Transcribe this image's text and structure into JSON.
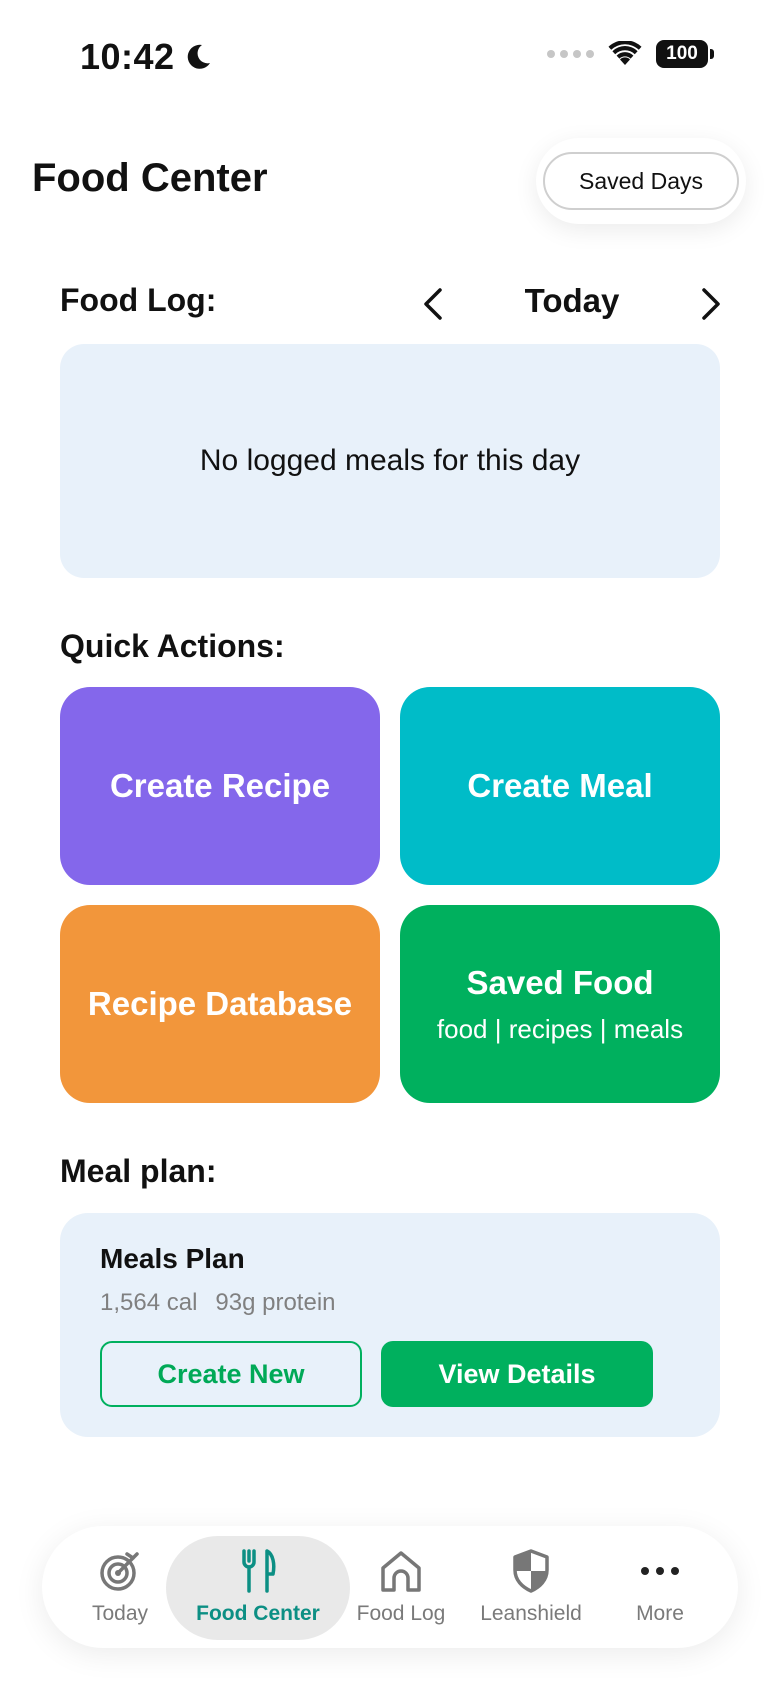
{
  "status_bar": {
    "time": "10:42",
    "battery": "100"
  },
  "header": {
    "title": "Food Center",
    "saved_days_label": "Saved Days"
  },
  "food_log": {
    "heading": "Food Log:",
    "day_label": "Today",
    "empty_message": "No logged meals for this day"
  },
  "quick_actions": {
    "heading": "Quick Actions:",
    "items": [
      {
        "label": "Create Recipe",
        "color": "#8467eb"
      },
      {
        "label": "Create Meal",
        "color": "#00bcc8"
      },
      {
        "label": "Recipe Database",
        "color": "#f2963b"
      },
      {
        "label": "Saved Food",
        "subtitle": "food | recipes | meals",
        "color": "#00b05e"
      }
    ]
  },
  "meal_plan": {
    "heading": "Meal plan:",
    "card_title": "Meals Plan",
    "calories": "1,564 cal",
    "protein": "93g protein",
    "create_new_label": "Create New",
    "view_details_label": "View Details"
  },
  "bottom_nav": {
    "active": "Food Center",
    "accent_color": "#0c8f84",
    "items": [
      {
        "label": "Today",
        "icon": "target-icon"
      },
      {
        "label": "Food Center",
        "icon": "fork-knife-icon"
      },
      {
        "label": "Food Log",
        "icon": "home-icon"
      },
      {
        "label": "Leanshield",
        "icon": "shield-icon"
      },
      {
        "label": "More",
        "icon": "more-dots-icon"
      }
    ]
  }
}
